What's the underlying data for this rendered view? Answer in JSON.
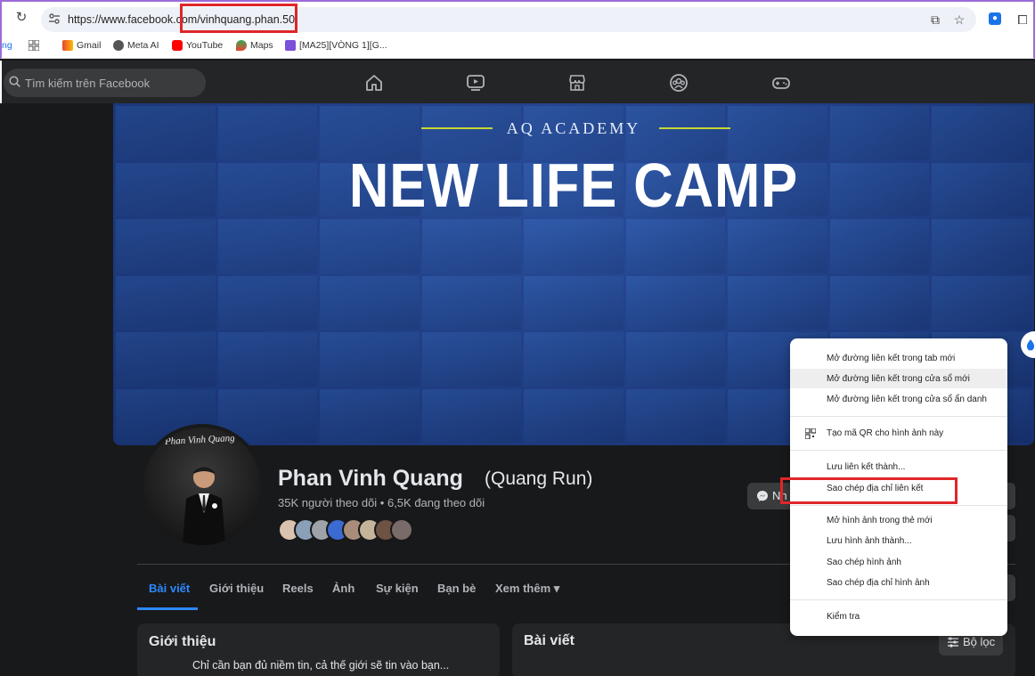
{
  "browser": {
    "url_prefix": "https://www.facebook.co",
    "url_rest": "m/vinhquang.phan.50",
    "bookmarks": [
      {
        "label": "ng"
      },
      {
        "label": "Gmail"
      },
      {
        "label": "Meta AI"
      },
      {
        "label": "YouTube"
      },
      {
        "label": "Maps"
      },
      {
        "label": "[MA25][VÒNG 1][G..."
      }
    ]
  },
  "facebook": {
    "search_placeholder": "Tìm kiếm trên Facebook",
    "cover": {
      "academy": "AQ ACADEMY",
      "headline": "NEW LIFE CAMP"
    },
    "avatar_signature": "Phan Vinh Quang",
    "profile_name": "Phan Vinh Quang",
    "alt_name": "(Quang Run)",
    "followers": "35K người theo dõi • 6,5K đang theo dõi",
    "message_button": "Nh",
    "tabs": [
      "Bài viết",
      "Giới thiệu",
      "Reels",
      "Ảnh",
      "Sự kiện",
      "Bạn bè",
      "Xem thêm ▾"
    ],
    "intro_title": "Giới thiệu",
    "intro_text": "Chỉ cần bạn đủ niềm tin, cả thế giới sẽ tin vào bạn...",
    "posts_title": "Bài viết",
    "filter_button": "Bộ lọc"
  },
  "context_menu": {
    "items": [
      "Mở đường liên kết trong tab mới",
      "Mở đường liên kết trong cửa sổ mới",
      "Mở đường liên kết trong cửa sổ ẩn danh",
      "Tạo mã QR cho hình ảnh này",
      "Lưu liên kết thành...",
      "Sao chép địa chỉ liên kết",
      "Mở hình ảnh trong thẻ mới",
      "Lưu hình ảnh thành...",
      "Sao chép hình ảnh",
      "Sao chép địa chỉ hình ảnh",
      "Kiểm tra"
    ]
  },
  "colors": {
    "highlight": "#e0262a",
    "fb_blue": "#2d88ff",
    "fb_bg": "#18191a"
  }
}
